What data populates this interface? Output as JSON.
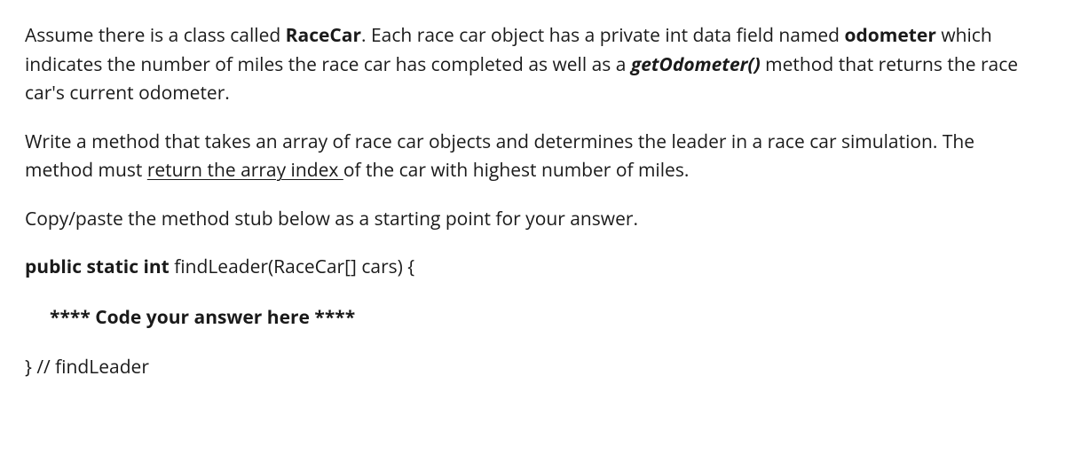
{
  "para1": {
    "t1": "Assume there is a class called ",
    "t2": "RaceCar",
    "t3": ".  Each race car object has a private int data field named ",
    "t4": "odometer",
    "t5": " which indicates the number of miles the race car has completed as well as a ",
    "t6": "getOdometer()",
    "t7": " method that returns the race car's current odometer."
  },
  "para2": {
    "t1": "Write a method that takes an array of race car objects and determines the leader in a race car simulation.  The method must ",
    "t2": "return the array index ",
    "t3": "of the car with highest number of miles."
  },
  "para3": "Copy/paste the method stub below as a starting point for your answer.",
  "code": {
    "sig1": "public static int",
    "sig2": " findLeader(RaceCar[] cars) {",
    "placeholder": "**** Code your answer here ****",
    "close": "} // findLeader"
  }
}
